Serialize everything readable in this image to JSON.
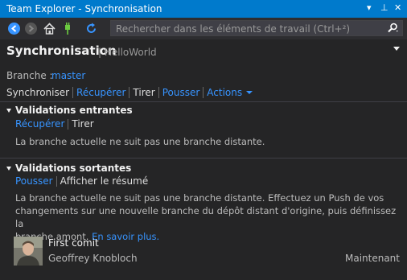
{
  "window": {
    "title": "Team Explorer - Synchronisation",
    "controls": [
      "▾",
      "⊥",
      "✕"
    ]
  },
  "toolbar": {
    "icons": [
      "back-icon",
      "forward-icon",
      "home-icon",
      "connect-icon",
      "refresh-icon"
    ],
    "search_placeholder": "Rechercher dans les éléments de travail (Ctrl+²)"
  },
  "header": {
    "title": "Synchronisation",
    "subtitle": "| HelloWorld"
  },
  "branch": {
    "label": "Branche :",
    "value": "master"
  },
  "nav": {
    "sync": "Synchroniser",
    "fetch": "Récupérer",
    "pull": "Tirer",
    "push": "Pousser",
    "actions": "Actions"
  },
  "incoming": {
    "title": "Validations entrantes",
    "fetch": "Récupérer",
    "pull": "Tirer",
    "message": "La branche actuelle ne suit pas une branche distante."
  },
  "outgoing": {
    "title": "Validations sortantes",
    "push": "Pousser",
    "summary": "Afficher le résumé",
    "message_line1": "La branche actuelle ne suit pas une branche distante. Effectuez un Push de vos",
    "message_line2": "changements sur une nouvelle branche du dépôt distant d'origine, puis définissez la",
    "message_line3": "branche amont.",
    "learn_more": "En savoir plus.",
    "commit": {
      "title": "First comit",
      "author": "Geoffrey Knobloch",
      "time": "Maintenant"
    }
  },
  "colors": {
    "accent": "#007acc",
    "link": "#3794ff",
    "background": "#252526"
  }
}
